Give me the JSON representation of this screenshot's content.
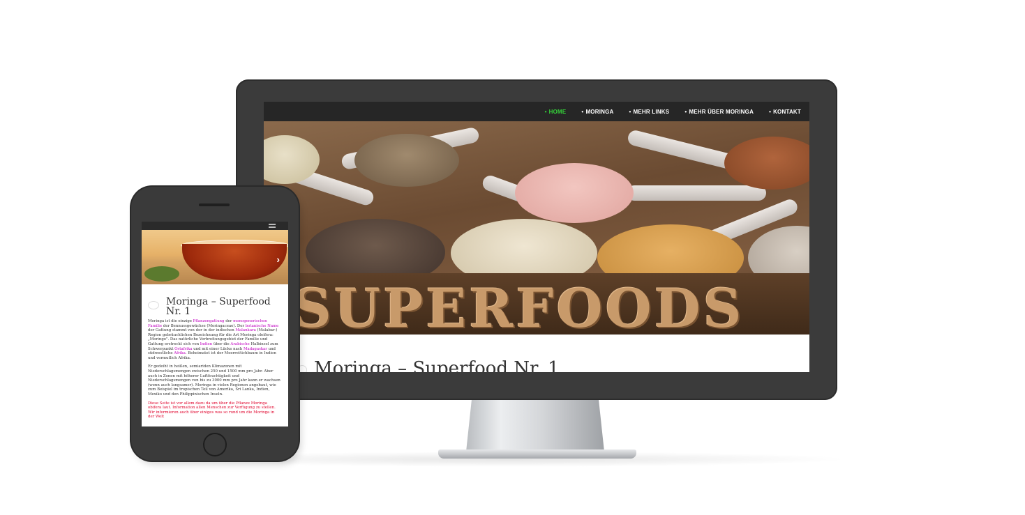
{
  "desktop": {
    "nav": {
      "items": [
        {
          "label": "HOME",
          "active": true
        },
        {
          "label": "MORINGA",
          "active": false
        },
        {
          "label": "MEHR LINKS",
          "active": false
        },
        {
          "label": "MEHR ÜBER MORINGA",
          "active": false
        },
        {
          "label": "KONTAKT",
          "active": false
        }
      ],
      "bullet": "•"
    },
    "hero_text": "SUPERFOODS",
    "page_title": "Moringa – Superfood Nr. 1"
  },
  "mobile": {
    "slider_next": "›",
    "page_title": "Moringa – Superfood Nr. 1",
    "paragraph1": {
      "parts": [
        {
          "text": "Moringa ist die einzige ",
          "link": false
        },
        {
          "text": "Pflanzengattung",
          "link": true
        },
        {
          "text": " der ",
          "link": false
        },
        {
          "text": "monogenerischen Familie",
          "link": true
        },
        {
          "text": " der Bennussgewächse (Moringaceae). Der ",
          "link": false
        },
        {
          "text": "botanische Name",
          "link": true
        },
        {
          "text": " der Gattung stammt von der in der indischen ",
          "link": false
        },
        {
          "text": "Malankara",
          "link": true
        },
        {
          "text": " (Malabar-) Region gebräuchlichen Bezeichnung für die Art Moringa oleifera: „Moringo\". Das natürliche Verbreitungsgebiet der Familie und Gattung erstreckt sich von ",
          "link": false
        },
        {
          "text": "Indien",
          "link": true
        },
        {
          "text": " über die ",
          "link": false
        },
        {
          "text": "Arabische",
          "link": true
        },
        {
          "text": " Halbinsel zum Schwerpunkt ",
          "link": false
        },
        {
          "text": "Ostafrika",
          "link": true
        },
        {
          "text": " und mit einer Lücke nach ",
          "link": false
        },
        {
          "text": "Madagaskar",
          "link": true
        },
        {
          "text": " und südwestliche ",
          "link": false
        },
        {
          "text": "Afrika",
          "link": true
        },
        {
          "text": ". Beheimatet ist der Meerrettichbaum in Indien und vermutlich Afrika.",
          "link": false
        }
      ]
    },
    "paragraph2": "Er gedeiht in heißen, semiariden Klimazonen mit Niederschlagsmengen zwischen 250 und 1500 mm pro Jahr. Aber auch in Zonen mit höherer Luftfeuchtigkeit und Niederschlagsmengen von bis zu 3000 mm pro Jahr kann er wachsen (wenn auch langsamer). Moringa in vielen Regionen angebaut, wie zum Beispiel im tropischen Teil von Amerika, Sri Lanka, Indien, Mexiko und den Philippinischen Inseln.",
    "paragraph3": "Diese Seite ist vor allem dazu da um über die Pflanze Moringa obifera laut. Information allen Menschen zur Verfügung zu stellen. Wir informieren auch über einiges was so rund um die Moringa in der Welt"
  },
  "colors": {
    "nav_active": "#34d039",
    "link": "#c000c0",
    "highlight_text": "#e0002a",
    "frame": "#3b3b3b"
  }
}
